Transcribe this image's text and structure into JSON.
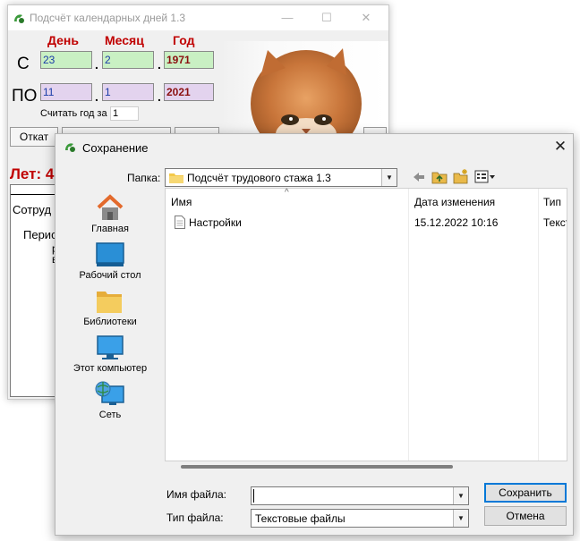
{
  "main_window": {
    "title": "Подсчёт календарных дней 1.3",
    "controls": {
      "minimize": "—",
      "maximize": "☐",
      "close": "✕"
    },
    "headers": {
      "day": "День",
      "month": "Месяц",
      "year": "Год"
    },
    "from_row": {
      "label": "С",
      "day": "23",
      "month": "2",
      "year": "1971"
    },
    "to_row": {
      "label": "ПО",
      "day": "11",
      "month": "1",
      "year": "2021"
    },
    "count_year_label": "Считать год за",
    "count_year_value": "1",
    "otkat_button": "Откат",
    "years_label": "Лет: 4",
    "report": {
      "line1": "Сотруд",
      "line2": "Перис",
      "line3": "р",
      "line4": "в"
    }
  },
  "dialog": {
    "title": "Сохранение",
    "folder_label": "Папка:",
    "folder_value": "Подсчёт трудового стажа 1.3",
    "places": [
      {
        "label": "Главная",
        "icon": "home-icon"
      },
      {
        "label": "Рабочий стол",
        "icon": "desktop-icon"
      },
      {
        "label": "Библиотеки",
        "icon": "libraries-icon"
      },
      {
        "label": "Этот компьютер",
        "icon": "computer-icon"
      },
      {
        "label": "Сеть",
        "icon": "network-icon"
      }
    ],
    "columns": {
      "name": "Имя",
      "date": "Дата изменения",
      "type": "Тип"
    },
    "files": [
      {
        "name": "Настройки",
        "date": "15.12.2022 10:16",
        "type": "Текст"
      }
    ],
    "filename_label": "Имя файла:",
    "filename_value": "",
    "filetype_label": "Тип файла:",
    "filetype_value": "Текстовые файлы",
    "save_button": "Сохранить",
    "cancel_button": "Отмена"
  },
  "colors": {
    "accent_red": "#c00000",
    "field_green": "#c9f0c3",
    "field_purple": "#e3d3ee",
    "folder_yellow": "#f3c94a"
  }
}
